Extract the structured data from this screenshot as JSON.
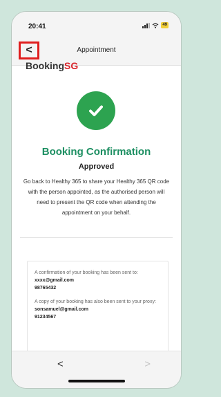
{
  "status_bar": {
    "time": "20:41",
    "battery": "49"
  },
  "nav": {
    "back_icon": "chevron-left-icon",
    "back_glyph": "<",
    "title": "Appointment"
  },
  "logo": {
    "text_main": "Booking",
    "text_accent": "SG",
    "accent_color": "#d8232a"
  },
  "confirmation": {
    "icon": "check-icon",
    "icon_color": "#2da350",
    "title": "Booking Confirmation",
    "title_color": "#1d8f62",
    "status": "Approved",
    "description": "Go back to Healthy 365 to share your Healthy 365 QR code with the person appointed, as the authorised person will need to present the QR code when attending the appointment on your behalf."
  },
  "info": {
    "email_intro": "A confirmation of your booking has been sent to:",
    "email": "xxxx@gmail.com",
    "phone": "98765432",
    "proxy_intro": "A copy of your booking has also been sent to your proxy:",
    "proxy_email": "sonsamuel@gmail.com",
    "proxy_phone": "91234567"
  },
  "browser_bar": {
    "prev_glyph": "<",
    "next_glyph": ">"
  }
}
